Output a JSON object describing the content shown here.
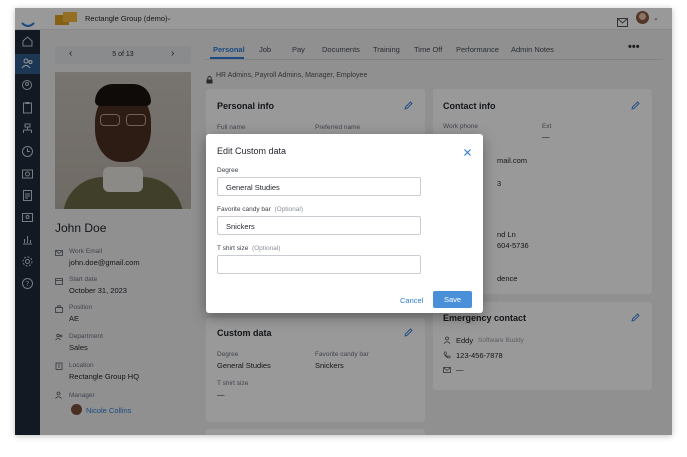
{
  "topbar": {
    "company": "Rectangle Group (demo)"
  },
  "profile": {
    "pager": "5 of 13",
    "name": "John Doe",
    "fields": [
      {
        "label": "Work Email",
        "value": "john.doe@gmail.com",
        "icon": "email-icon"
      },
      {
        "label": "Start date",
        "value": "October 31, 2023",
        "icon": "calendar-icon"
      },
      {
        "label": "Position",
        "value": "AE",
        "icon": "briefcase-icon"
      },
      {
        "label": "Department",
        "value": "Sales",
        "icon": "people-icon"
      },
      {
        "label": "Location",
        "value": "Rectangle Group HQ",
        "icon": "building-icon"
      }
    ],
    "manager_label": "Manager",
    "manager_name": "Nicole Collins"
  },
  "tabs": [
    "Personal",
    "Job",
    "Pay",
    "Documents",
    "Training",
    "Time Off",
    "Performance",
    "Admin Notes"
  ],
  "access_note": "HR Admins, Payroll Admins, Manager, Employee",
  "personal_info": {
    "title": "Personal info",
    "full_name_label": "Full name",
    "preferred_name_label": "Preferred name"
  },
  "contact_info": {
    "title": "Contact info",
    "work_phone_label": "Work phone",
    "ext_label": "Ext",
    "ext_value": "—",
    "email_fragment": "mail.com",
    "phone_fragment": "3",
    "address_fragment": "nd Ln",
    "phone2_fragment": "604-5736",
    "residence_fragment": "dence"
  },
  "custom_data": {
    "title": "Custom data",
    "degree_label": "Degree",
    "degree_value": "General Studies",
    "candy_label": "Favorite candy bar",
    "candy_value": "Snickers",
    "shirt_label": "T shirt size",
    "shirt_value": "—"
  },
  "emergency_contact": {
    "title": "Emergency contact",
    "name": "Eddy",
    "relation": "Software Buddy",
    "phone": "123-456-7878",
    "email": "—"
  },
  "modal": {
    "title": "Edit Custom data",
    "degree_label": "Degree",
    "degree_value": "General Studies",
    "candy_label": "Favorite candy bar",
    "candy_optional": "(Optional)",
    "candy_value": "Snickers",
    "shirt_label": "T shirt size",
    "shirt_optional": "(Optional)",
    "shirt_value": "",
    "cancel_label": "Cancel",
    "save_label": "Save"
  },
  "colors": {
    "accent": "#2f7bd6",
    "sidebar": "#1e2a3a",
    "save_button": "#4a90d9"
  }
}
